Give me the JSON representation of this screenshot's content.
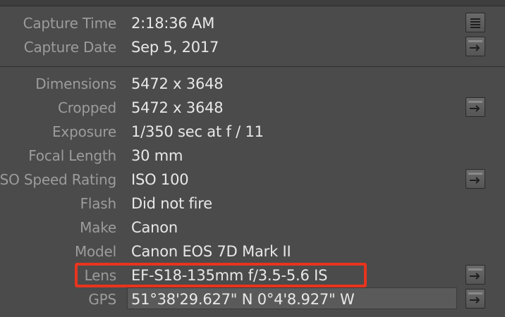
{
  "metadata": {
    "rows": [
      {
        "label": "Capture Time",
        "value": "2:18:36 AM"
      },
      {
        "label": "Capture Date",
        "value": "Sep 5, 2017"
      },
      {
        "label": "Dimensions",
        "value": "5472 x 3648"
      },
      {
        "label": "Cropped",
        "value": "5472 x 3648"
      },
      {
        "label": "Exposure",
        "value": "1/350 sec at f / 11"
      },
      {
        "label": "Focal Length",
        "value": "30 mm"
      },
      {
        "label": "ISO Speed Rating",
        "value": "ISO 100"
      },
      {
        "label": "Flash",
        "value": "Did not fire"
      },
      {
        "label": "Make",
        "value": "Canon"
      },
      {
        "label": "Model",
        "value": "Canon EOS 7D Mark II"
      },
      {
        "label": "Lens",
        "value": "EF-S18-135mm f/3.5-5.6 IS"
      },
      {
        "label": "GPS",
        "value": "51°38'29.627\" N 0°4'8.927\" W"
      }
    ]
  },
  "icons": {
    "list": "list-icon",
    "arrow": "arrow-right-icon"
  },
  "colors": {
    "background": "#4b4b4b",
    "label": "#9c9c9c",
    "value": "#e8e8e8",
    "highlight": "#e8341e"
  }
}
